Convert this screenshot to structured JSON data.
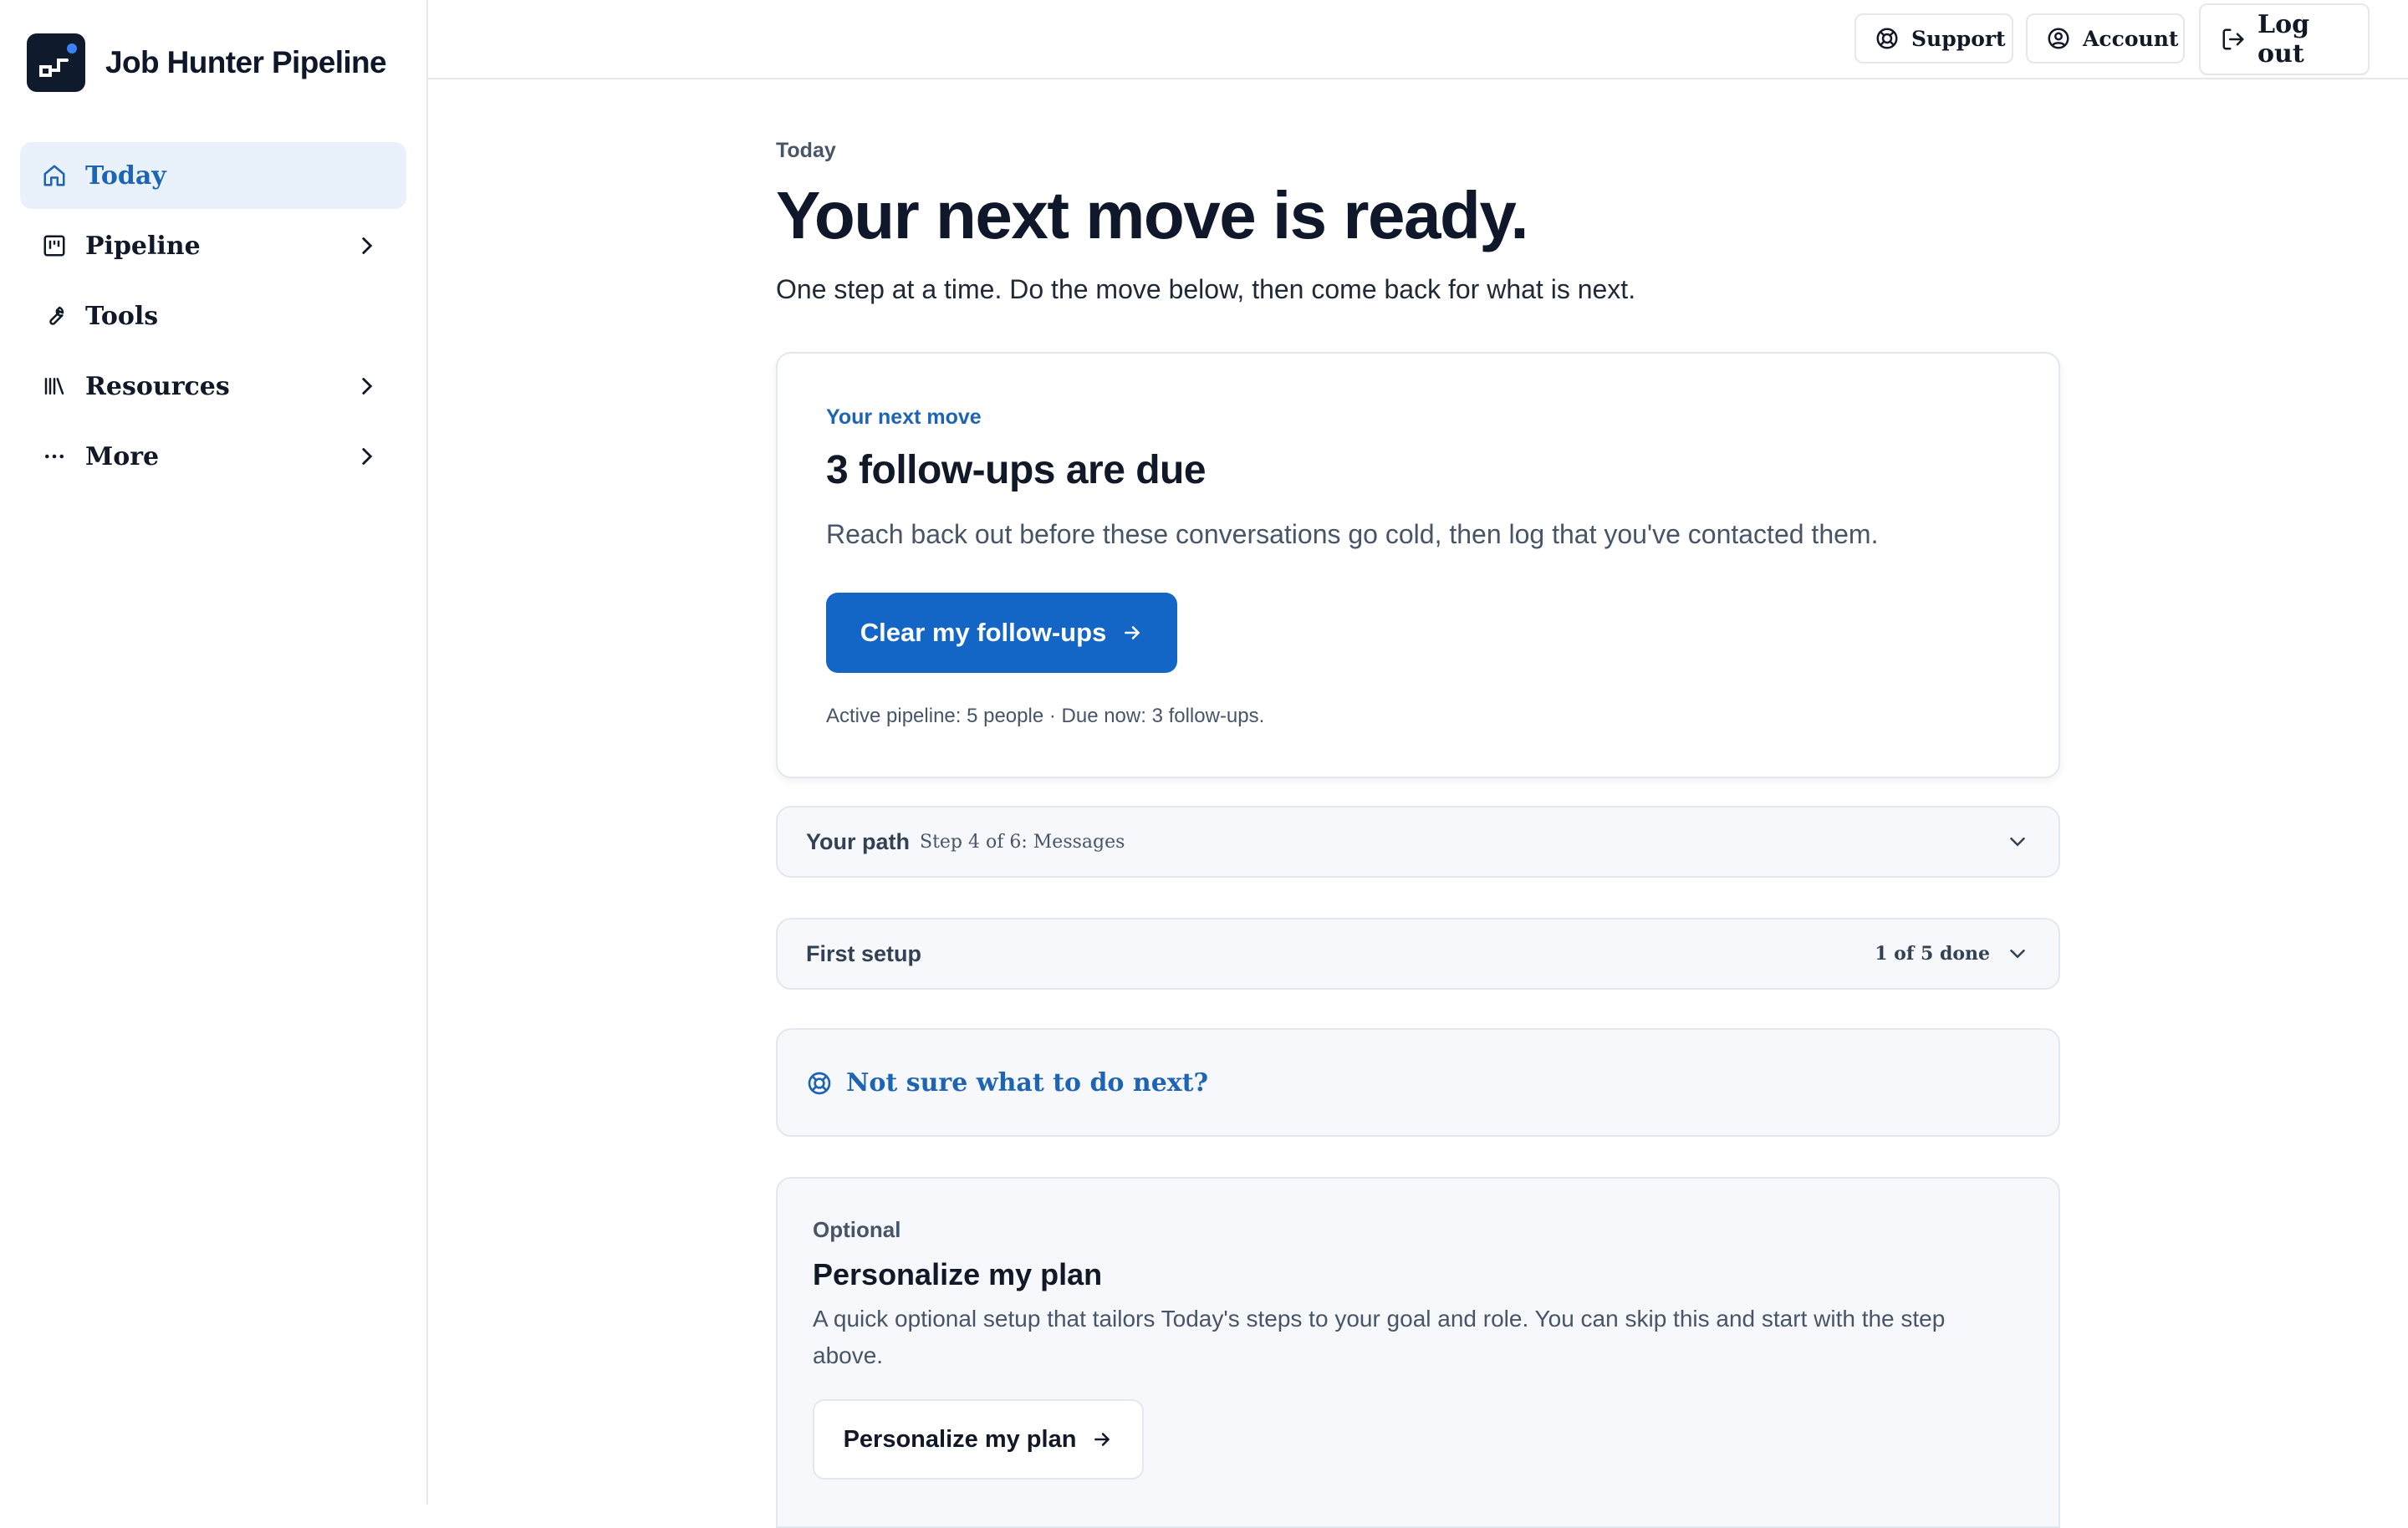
{
  "app": {
    "name": "Job Hunter Pipeline"
  },
  "sidebar": {
    "items": [
      {
        "label": "Today",
        "icon": "home-icon",
        "active": true
      },
      {
        "label": "Pipeline",
        "icon": "kanban-icon",
        "has_submenu": true
      },
      {
        "label": "Tools",
        "icon": "wrench-icon"
      },
      {
        "label": "Resources",
        "icon": "library-icon",
        "has_submenu": true
      },
      {
        "label": "More",
        "icon": "ellipsis-icon",
        "has_submenu": true
      }
    ]
  },
  "topbar": {
    "support_label": "Support",
    "account_label": "Account",
    "logout_label": "Log out"
  },
  "page": {
    "eyebrow": "Today",
    "title": "Your next move is ready.",
    "subtitle": "One step at a time. Do the move below, then come back for what is next."
  },
  "next_move": {
    "eyebrow": "Your next move",
    "title": "3 follow-ups are due",
    "description": "Reach back out before these conversations go cold, then log that you've contacted them.",
    "button_label": "Clear my follow-ups",
    "meta": "Active pipeline: 5 people · Due now: 3 follow-ups."
  },
  "path": {
    "title": "Your path",
    "step": "Step 4 of 6: Messages"
  },
  "setup": {
    "title": "First setup",
    "progress": "1 of 5 done"
  },
  "help": {
    "label": "Not sure what to do next?"
  },
  "optional": {
    "eyebrow": "Optional",
    "title": "Personalize my plan",
    "description": "A quick optional setup that tailors Today's steps to your goal and role. You can skip this and start with the step above.",
    "button_label": "Personalize my plan"
  },
  "colors": {
    "accent": "#1366c6",
    "accent_text": "#1e64b4",
    "active_nav_bg": "#e9f2fb",
    "card_muted_bg": "#f6f8fb",
    "logo_bg": "#0f1b2d"
  }
}
